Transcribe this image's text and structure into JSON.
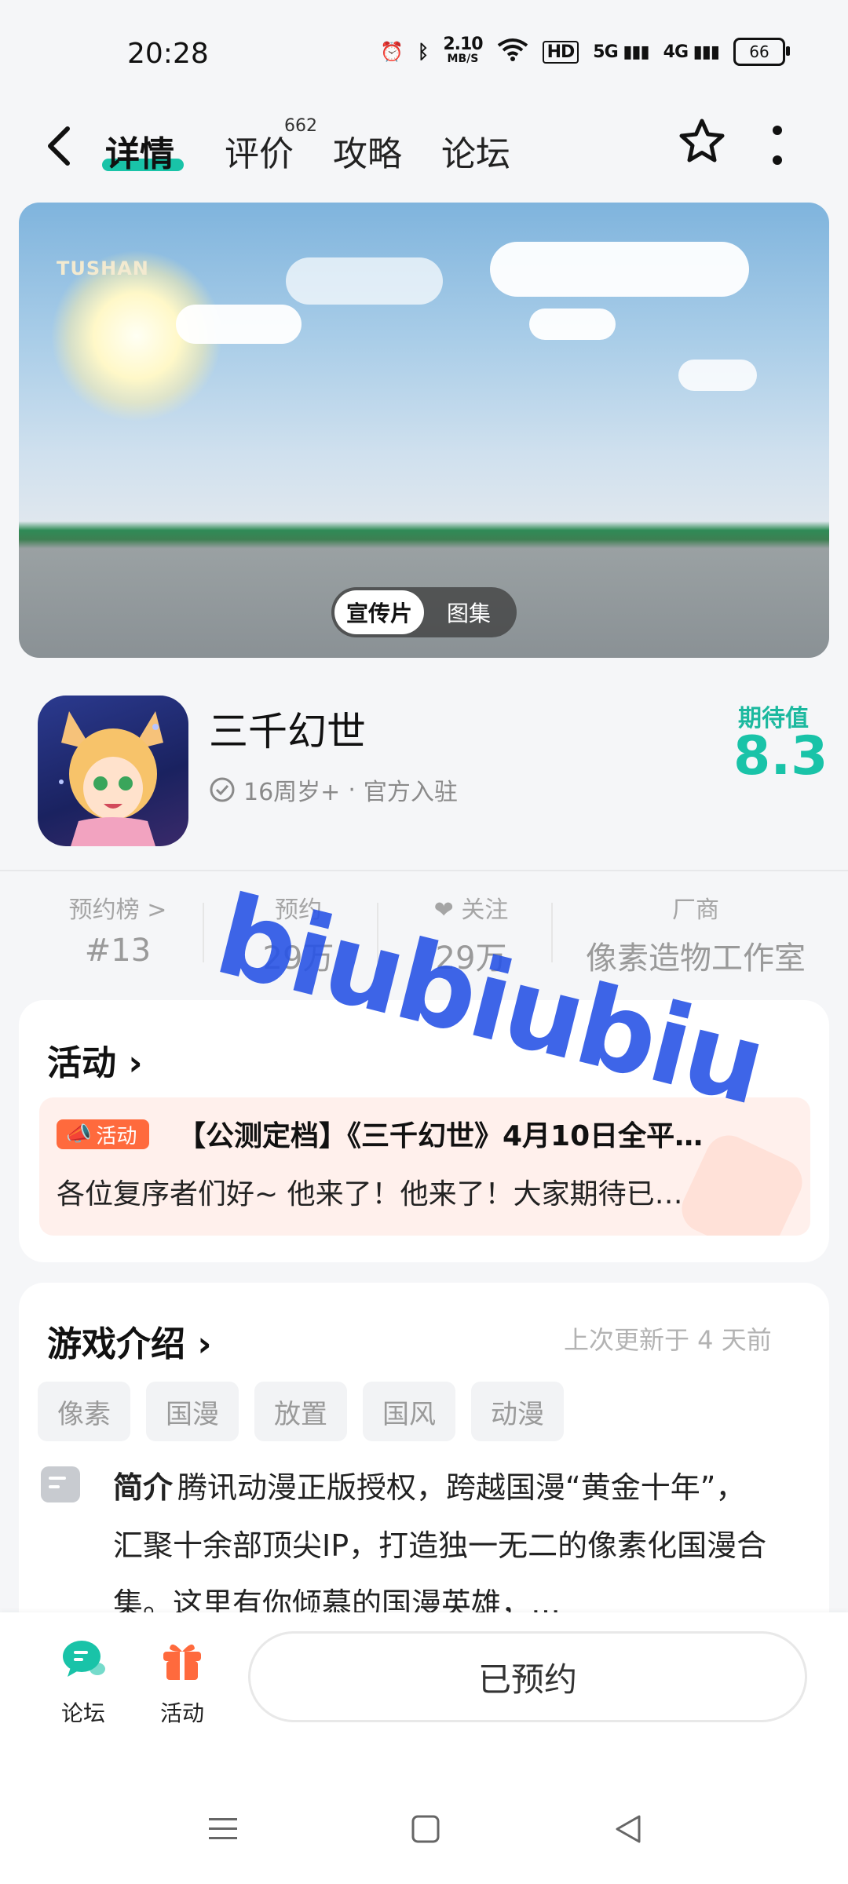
{
  "status_bar": {
    "time": "20:28",
    "net_speed_value": "2.10",
    "net_speed_unit": "MB/S",
    "hd": "HD",
    "sig1": "5G",
    "sig2": "4G",
    "battery": "66"
  },
  "nav": {
    "tabs": [
      {
        "label": "详情",
        "active": true
      },
      {
        "label": "评价",
        "badge": "662"
      },
      {
        "label": "攻略"
      },
      {
        "label": "论坛"
      }
    ]
  },
  "banner": {
    "watermark": "TUSHAN",
    "switch": [
      "宣传片",
      "图集"
    ]
  },
  "game": {
    "title": "三千幻世",
    "age": "16周岁+",
    "sep": "·",
    "official": "官方入驻",
    "expect_label": "期待值",
    "expect_value": "8.3"
  },
  "stats": [
    {
      "label": "预约榜 >",
      "value": "#13"
    },
    {
      "label": "预约",
      "value": "29万"
    },
    {
      "label": "关注",
      "value": "29万"
    },
    {
      "label": "厂商",
      "value": "像素造物工作室"
    }
  ],
  "overlay_watermark": "biubiubiu",
  "activity": {
    "title": "活动",
    "badge": "活动",
    "headline": "【公测定档】《三千幻世》4月10日全平…",
    "body": "各位复序者们好~ 他来了！他来了！大家期待已…"
  },
  "intro": {
    "title": "游戏介绍",
    "updated": "上次更新于 4 天前",
    "tags": [
      "像素",
      "国漫",
      "放置",
      "国风",
      "动漫"
    ],
    "desc_label": "简介",
    "desc_text": "腾讯动漫正版授权，跨越国漫“黄金十年”，汇聚十余部顶尖IP，打造独一无二的像素化国漫合集。这里有你倾慕的国漫英雄，…"
  },
  "bottom": {
    "forum": "论坛",
    "activity": "活动",
    "reserve": "已预约"
  },
  "colors": {
    "accent": "#19c3a8",
    "orange": "#ff6a3d",
    "watermark": "#2a55e6"
  }
}
